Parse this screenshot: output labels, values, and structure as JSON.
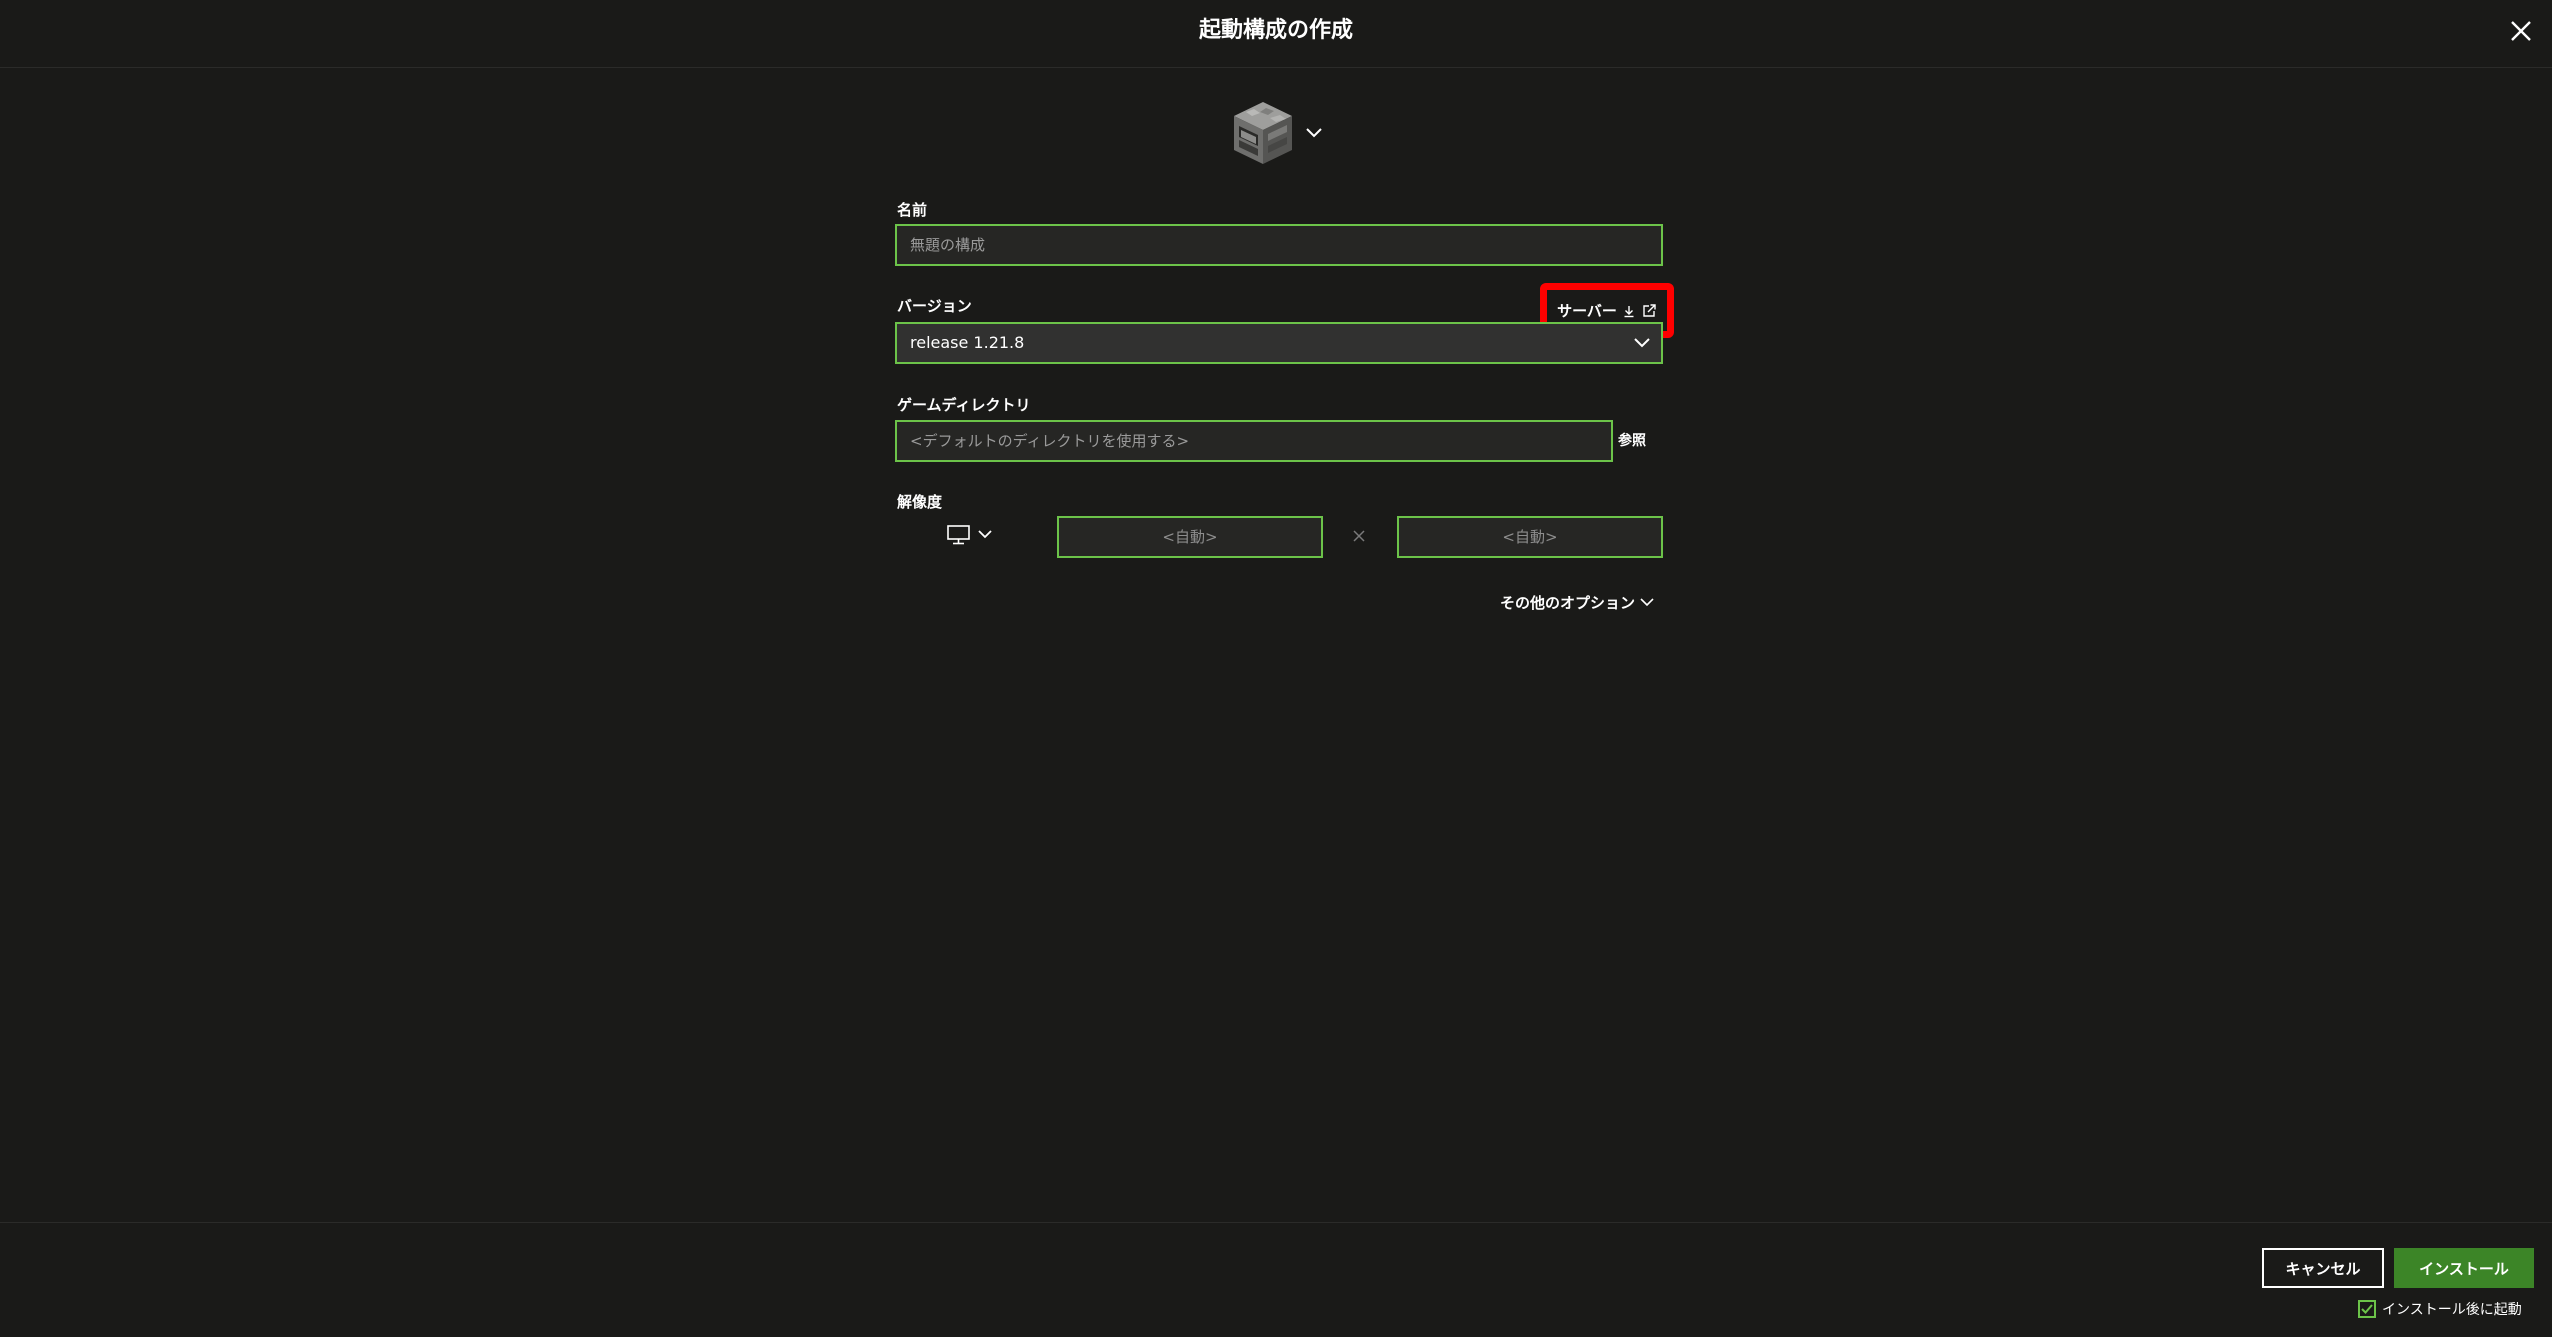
{
  "header": {
    "title": "起動構成の作成",
    "close_icon": "close-icon"
  },
  "icon_selector": {
    "icon": "furnace-block-icon",
    "chevron": "chevron-down-icon"
  },
  "name_field": {
    "label": "名前",
    "placeholder": "無題の構成",
    "value": ""
  },
  "version_field": {
    "label": "バージョン",
    "selected": "release 1.21.8",
    "server_link": {
      "label": "サーバー",
      "icons": [
        "download-icon",
        "external-link-icon"
      ]
    }
  },
  "game_directory": {
    "label": "ゲームディレクトリ",
    "placeholder": "<デフォルトのディレクトリを使用する>",
    "browse_label": "参照"
  },
  "resolution": {
    "label": "解像度",
    "monitor_icon": "monitor-icon",
    "width_placeholder": "<自動>",
    "height_placeholder": "<自動>",
    "separator_icon": "times-icon"
  },
  "more_options": {
    "label": "その他のオプション"
  },
  "footer": {
    "cancel_label": "キャンセル",
    "install_label": "インストール",
    "launch_after_install": {
      "label": "インストール後に起動",
      "checked": true
    }
  },
  "colors": {
    "background": "#1a1a18",
    "accent_border": "#6cc349",
    "install_button": "#3c8527",
    "highlight_box": "#ff0000"
  }
}
